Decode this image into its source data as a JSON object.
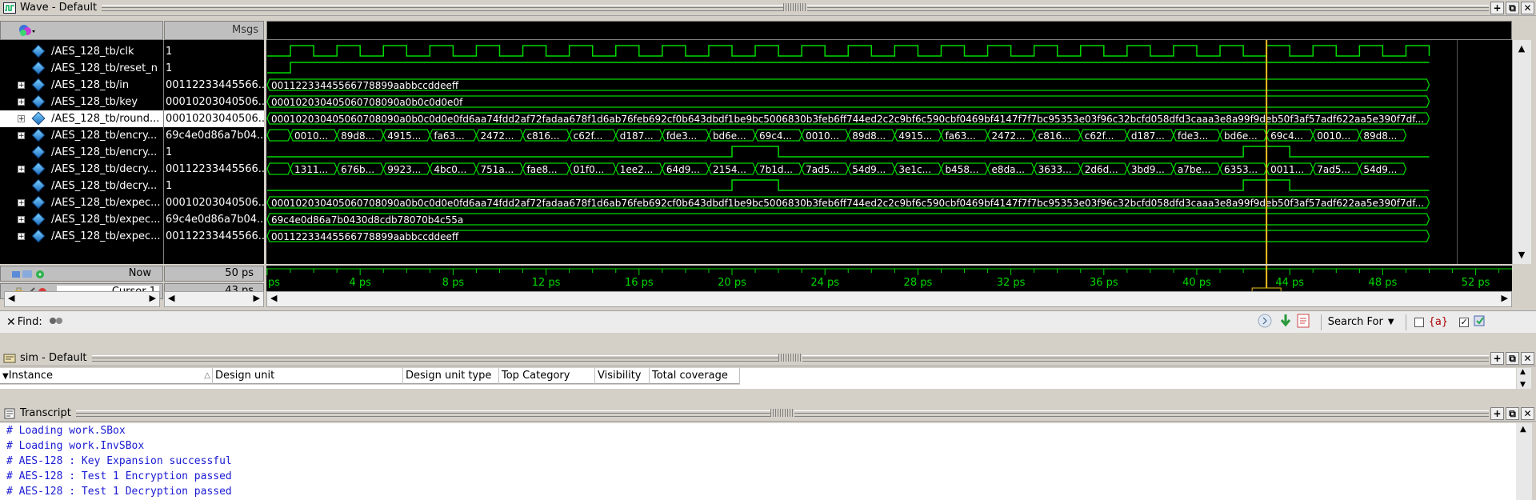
{
  "wave_window": {
    "title": "Wave - Default",
    "msgs_label": "Msgs",
    "signals": [
      {
        "name": "/AES_128_tb/clk",
        "value": "1",
        "expandable": false
      },
      {
        "name": "/AES_128_tb/reset_n",
        "value": "1",
        "expandable": false
      },
      {
        "name": "/AES_128_tb/in",
        "value": "00112233445566...",
        "expandable": true
      },
      {
        "name": "/AES_128_tb/key",
        "value": "00010203040506...",
        "expandable": true
      },
      {
        "name": "/AES_128_tb/round...",
        "value": "00010203040506...",
        "expandable": true,
        "selected": true
      },
      {
        "name": "/AES_128_tb/encry...",
        "value": "69c4e0d86a7b04...",
        "expandable": true
      },
      {
        "name": "/AES_128_tb/encry...",
        "value": "1",
        "expandable": false
      },
      {
        "name": "/AES_128_tb/decry...",
        "value": "00112233445566...",
        "expandable": true
      },
      {
        "name": "/AES_128_tb/decry...",
        "value": "1",
        "expandable": false
      },
      {
        "name": "/AES_128_tb/expec...",
        "value": "00010203040506...",
        "expandable": true
      },
      {
        "name": "/AES_128_tb/expec...",
        "value": "69c4e0d86a7b04...",
        "expandable": true
      },
      {
        "name": "/AES_128_tb/expec...",
        "value": "00112233445566...",
        "expandable": true
      }
    ],
    "wave_texts": {
      "in": "00112233445566778899aabbccddeeff",
      "key": "000102030405060708090a0b0c0d0e0f",
      "round_keys": "000102030405060708090a0b0c0d0e0fd6aa74fdd2af72fadaa678f1d6ab76feb692cf0b643dbdf1be9bc5006830b3feb6ff744ed2c2c9bf6c590cbf0469bf4147f7f7bc95353e03f96c32bcfd058dfd3caaa3e8a99f9deb50f3af57adf622aa5e390f7df...",
      "expected_round_keys": "000102030405060708090a0b0c0d0e0fd6aa74fdd2af72fadaa678f1d6ab76feb692cf0b643dbdf1be9bc5006830b3feb6ff744ed2c2c9bf6c590cbf0469bf4147f7f7bc95353e03f96c32bcfd058dfd3caaa3e8a99f9deb50f3af57adf622aa5e390f7df...",
      "expected_encrypted": "69c4e0d86a7b0430d8cdb78070b4c55a",
      "expected_decrypted": "00112233445566778899aabbccddeeff",
      "encrypted_segments": [
        "0010...",
        "89d8...",
        "4915...",
        "fa63...",
        "2472...",
        "c816...",
        "c62f...",
        "d187...",
        "fde3...",
        "bd6e...",
        "69c4...",
        "0010...",
        "89d8...",
        "4915...",
        "fa63...",
        "2472...",
        "c816...",
        "c62f...",
        "d187...",
        "fde3...",
        "bd6e...",
        "69c4...",
        "0010...",
        "89d8..."
      ],
      "decrypted_segments": [
        "1311...",
        "676b...",
        "9923...",
        "4bc0...",
        "751a...",
        "fae8...",
        "01f0...",
        "1ee2...",
        "64d9...",
        "2154...",
        "7b1d...",
        "7ad5...",
        "54d9...",
        "3e1c...",
        "b458...",
        "e8da...",
        "3633...",
        "2d6d...",
        "3bd9...",
        "a7be...",
        "6353...",
        "0011...",
        "7ad5...",
        "54d9..."
      ]
    },
    "now_label": "Now",
    "now_value": "50 ps",
    "cursor_label": "Cursor 1",
    "cursor_value": "43 ps",
    "cursor_tag": "43 ps",
    "cursor_time_ps": 43,
    "time_ticks": [
      "ps",
      "4 ps",
      "8 ps",
      "12 ps",
      "16 ps",
      "20 ps",
      "24 ps",
      "28 ps",
      "32 ps",
      "36 ps",
      "40 ps",
      "44 ps",
      "48 ps",
      "52 ps"
    ],
    "find_label": "Find:",
    "search_for_label": "Search For"
  },
  "sim_window": {
    "title": "sim - Default",
    "columns": [
      "Instance",
      "Design unit",
      "Design unit type",
      "Top Category",
      "Visibility",
      "Total coverage"
    ]
  },
  "transcript_window": {
    "title": "Transcript",
    "lines": [
      "# Loading work.SBox",
      "# Loading work.InvSBox",
      "# AES-128 : Key Expansion successful",
      "# AES-128 : Test 1 Encryption passed",
      "# AES-128 : Test 1 Decryption passed"
    ]
  },
  "colors": {
    "wave_green": "#00d800",
    "cursor_yellow": "#f0c020",
    "transcript_blue": "#1a1ad4",
    "time_text": "#00d800"
  }
}
